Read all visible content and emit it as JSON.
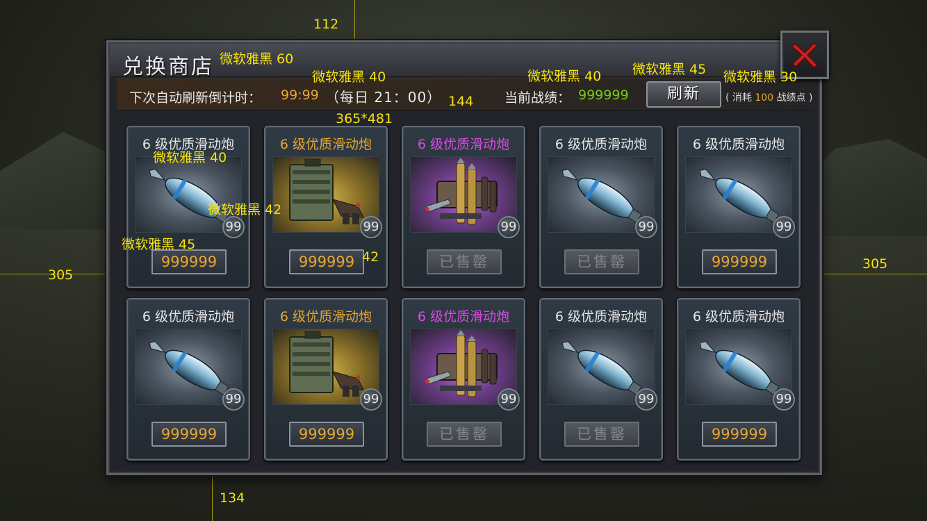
{
  "shop": {
    "title": "兑换商店",
    "refresh_label": "下次自动刷新倒计时：",
    "countdown": "99:99",
    "daily_refresh": "（每日 21：00）",
    "score_label": "当前战绩：",
    "score_value": "999999",
    "refresh_button": "刷新",
    "cost_prefix": "( 消耗",
    "cost_amount": "100",
    "cost_suffix": "战绩点 )",
    "close_icon": "close-x-icon"
  },
  "colors": {
    "name_white": "#e6e6e6",
    "name_gold": "#e7a632",
    "name_purple": "#d74be3",
    "price": "#e7a632",
    "score": "#78c81e"
  },
  "items": [
    {
      "name": "6 级优质滑动炮",
      "rarity": "white",
      "icon": "mortar-shell-icon",
      "quantity": "99",
      "price": "999999",
      "sold_out": false
    },
    {
      "name": "6 级优质滑动炮",
      "rarity": "gold",
      "icon": "ammo-box-icon",
      "quantity": "99",
      "price": "999999",
      "sold_out": false
    },
    {
      "name": "6 级优质滑动炮",
      "rarity": "purple",
      "icon": "ammo-pack-icon",
      "quantity": "99",
      "price": "已售罄",
      "sold_out": true
    },
    {
      "name": "6 级优质滑动炮",
      "rarity": "white",
      "icon": "mortar-shell-icon",
      "quantity": "99",
      "price": "已售罄",
      "sold_out": true
    },
    {
      "name": "6 级优质滑动炮",
      "rarity": "white",
      "icon": "mortar-shell-icon",
      "quantity": "99",
      "price": "999999",
      "sold_out": false
    },
    {
      "name": "6 级优质滑动炮",
      "rarity": "white",
      "icon": "mortar-shell-icon",
      "quantity": "99",
      "price": "999999",
      "sold_out": false
    },
    {
      "name": "6 级优质滑动炮",
      "rarity": "gold",
      "icon": "ammo-box-icon",
      "quantity": "99",
      "price": "999999",
      "sold_out": false
    },
    {
      "name": "6 级优质滑动炮",
      "rarity": "purple",
      "icon": "ammo-pack-icon",
      "quantity": "99",
      "price": "已售罄",
      "sold_out": true
    },
    {
      "name": "6 级优质滑动炮",
      "rarity": "white",
      "icon": "mortar-shell-icon",
      "quantity": "99",
      "price": "已售罄",
      "sold_out": true
    },
    {
      "name": "6 级优质滑动炮",
      "rarity": "white",
      "icon": "mortar-shell-icon",
      "quantity": "99",
      "price": "999999",
      "sold_out": false
    }
  ],
  "annotations": {
    "top_margin": "112",
    "left_margin": "305",
    "right_margin": "305",
    "bottom_margin": "134",
    "header_offset": "144",
    "panel_size": "365*481",
    "price_gap": "42",
    "font_title": "微软雅黑 60",
    "font_refresh": "微软雅黑 40",
    "font_score": "微软雅黑 40",
    "font_button": "微软雅黑 45",
    "font_cost": "微软雅黑 30",
    "font_item_name": "微软雅黑 40",
    "font_quantity": "微软雅黑 42",
    "font_price": "微软雅黑 45"
  }
}
